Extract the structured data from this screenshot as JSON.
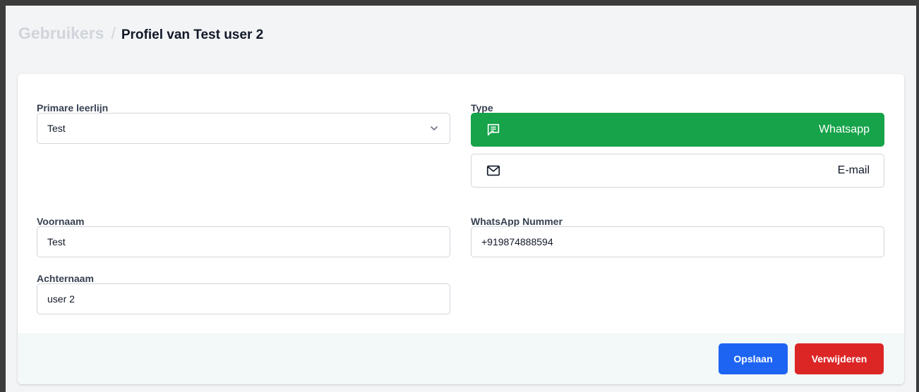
{
  "breadcrumb": {
    "root": "Gebruikers",
    "separator": "/",
    "current": "Profiel van Test user 2"
  },
  "form": {
    "primary_line": {
      "label": "Primare leerlijn",
      "value": "Test"
    },
    "type": {
      "label": "Type",
      "options": [
        {
          "label": "Whatsapp",
          "icon": "message-icon",
          "selected": true
        },
        {
          "label": "E-mail",
          "icon": "mail-icon",
          "selected": false
        }
      ]
    },
    "first_name": {
      "label": "Voornaam",
      "value": "Test"
    },
    "last_name": {
      "label": "Achternaam",
      "value": "user 2"
    },
    "whatsapp_number": {
      "label": "WhatsApp Nummer",
      "value": "+919874888594"
    }
  },
  "actions": {
    "save_label": "Opslaan",
    "delete_label": "Verwijderen"
  },
  "colors": {
    "whatsapp_active": "#16a34a",
    "save": "#1d64f2",
    "delete": "#dc2626"
  }
}
